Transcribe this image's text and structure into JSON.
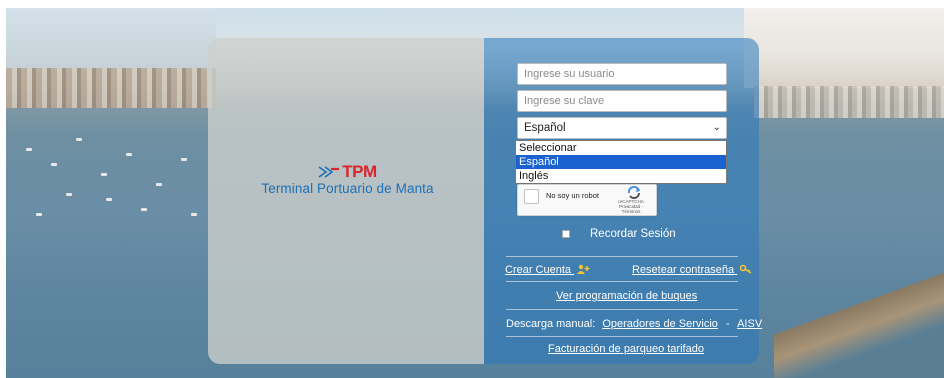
{
  "brand": {
    "mark": "TPM",
    "name": "Terminal Portuario de Manta",
    "mark_color": "#d9262c",
    "name_color": "#1f6fb5"
  },
  "login": {
    "username_placeholder": "Ingrese su usuario",
    "password_placeholder": "Ingrese su clave",
    "language_selected": "Español",
    "language_options": [
      "Seleccionar",
      "Español",
      "Inglés"
    ],
    "captcha_label": "No soy un robot",
    "captcha_brand": "reCAPTCHA",
    "captcha_links": "Privacidad - Términos",
    "remember_label": "Recordar Sesión"
  },
  "links": {
    "create_account": "Crear Cuenta",
    "reset_password": "Resetear contraseña",
    "vessel_schedule": "Ver programación de buques",
    "manual_download_label": "Descarga manual:",
    "service_operators": "Operadores de Servicio",
    "separator": "-",
    "aisv": "AISV",
    "parking_billing": "Facturación de parqueo tarifado"
  },
  "icons": {
    "create_account": "user-add-icon",
    "reset_password": "key-icon",
    "select_chevron": "chevron-down-icon",
    "captcha": "recaptcha-icon"
  },
  "colors": {
    "right_panel": "#2878be",
    "left_panel": "#cdd0cd",
    "dropdown_highlight": "#1a62d0"
  }
}
